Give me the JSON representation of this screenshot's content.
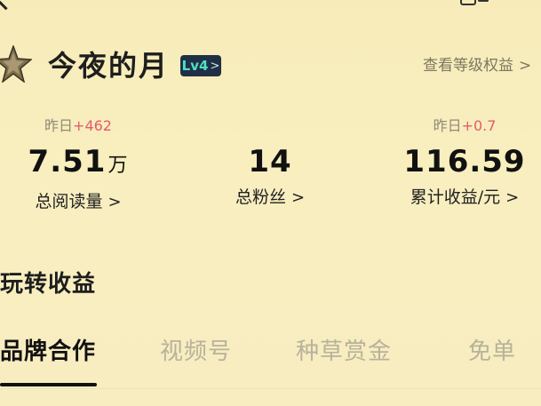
{
  "profile": {
    "username": "今夜的月",
    "level": "Lv4",
    "level_arrow": ">",
    "level_rights_link": "查看等级权益",
    "level_rights_chevron": ">"
  },
  "stats": [
    {
      "delta_prefix": "",
      "delta_value": "",
      "value": "7.51",
      "unit": "万",
      "label": "总阅读量",
      "chevron": ">"
    },
    {
      "delta_prefix": "",
      "delta_value": "",
      "value": "14",
      "unit": "",
      "label": "总粉丝",
      "chevron": ">"
    },
    {
      "delta_prefix": "昨日",
      "delta_value": "+0.7",
      "value": "116.59",
      "unit": "",
      "label": "累计收益/元",
      "chevron": ">"
    }
  ],
  "stats_reads_delta": {
    "prefix": "昨日",
    "value": "+462"
  },
  "section": {
    "title": "玩转收益"
  },
  "tabs": [
    {
      "label": "品牌合作",
      "active": true
    },
    {
      "label": "视频号",
      "active": false
    },
    {
      "label": "种草赏金",
      "active": false
    },
    {
      "label": "免单",
      "active": false
    }
  ],
  "colors": {
    "background": "#f7ecb9",
    "positive_delta": "#e45a6d",
    "badge_bg": "#1f3046",
    "badge_text": "#4fe0c5",
    "muted_text": "#8f8b78"
  },
  "icons": {
    "back": "chevron-left-icon",
    "top_right": "menu-icon",
    "avatar": "star-icon"
  }
}
